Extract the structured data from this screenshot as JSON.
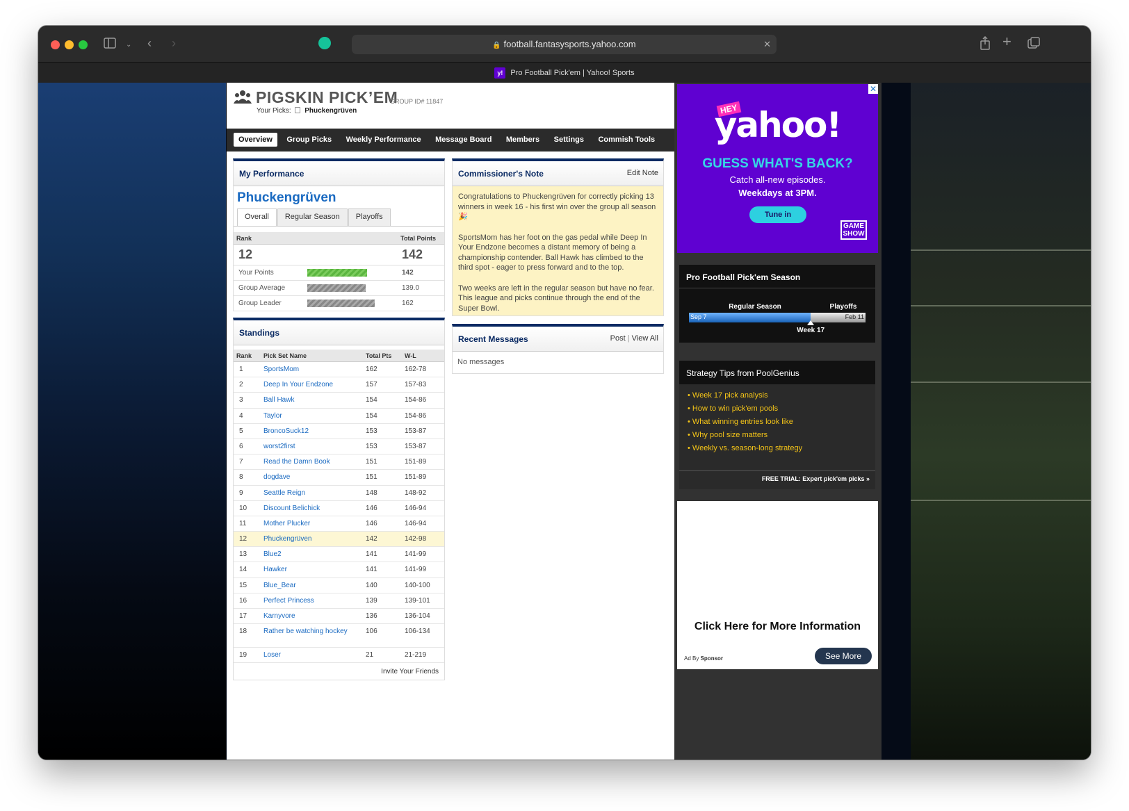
{
  "browser": {
    "url": "football.fantasysports.yahoo.com",
    "tab_title": "Pro Football Pick'em | Yahoo! Sports",
    "tab_favicon": "y!"
  },
  "header": {
    "brand": "PIGSKIN PICK’EM",
    "group_id": "GROUP ID# 11847",
    "your_picks_label": "Your Picks:",
    "your_picks_name": "Phuckengrüven"
  },
  "nav": [
    "Overview",
    "Group Picks",
    "Weekly Performance",
    "Message Board",
    "Members",
    "Settings",
    "Commish Tools"
  ],
  "performance": {
    "title": "My Performance",
    "name": "Phuckengrüven",
    "tabs": [
      "Overall",
      "Regular Season",
      "Playoffs"
    ],
    "rank_label": "Rank",
    "points_label": "Total Points",
    "rank": "12",
    "total_points": "142",
    "rows": [
      {
        "label": "Your Points",
        "value": "142"
      },
      {
        "label": "Group Average",
        "value": "139.0"
      },
      {
        "label": "Group Leader",
        "value": "162"
      }
    ]
  },
  "standings": {
    "title": "Standings",
    "headers": [
      "Rank",
      "Pick Set Name",
      "Total Pts",
      "W-L"
    ],
    "rows": [
      [
        "1",
        "SportsMom",
        "162",
        "162-78"
      ],
      [
        "2",
        "Deep In Your Endzone",
        "157",
        "157-83"
      ],
      [
        "3",
        "Ball Hawk",
        "154",
        "154-86"
      ],
      [
        "4",
        "Taylor",
        "154",
        "154-86"
      ],
      [
        "5",
        "BroncoSuck12",
        "153",
        "153-87"
      ],
      [
        "6",
        "worst2first",
        "153",
        "153-87"
      ],
      [
        "7",
        "Read the Damn Book",
        "151",
        "151-89"
      ],
      [
        "8",
        "dogdave",
        "151",
        "151-89"
      ],
      [
        "9",
        "Seattle Reign",
        "148",
        "148-92"
      ],
      [
        "10",
        "Discount Belichick",
        "146",
        "146-94"
      ],
      [
        "11",
        "Mother Plucker",
        "146",
        "146-94"
      ],
      [
        "12",
        "Phuckengrüven",
        "142",
        "142-98"
      ],
      [
        "13",
        "Blue2",
        "141",
        "141-99"
      ],
      [
        "14",
        "Hawker",
        "141",
        "141-99"
      ],
      [
        "15",
        "Blue_Bear",
        "140",
        "140-100"
      ],
      [
        "16",
        "Perfect Princess",
        "139",
        "139-101"
      ],
      [
        "17",
        "Karnyvore",
        "136",
        "136-104"
      ],
      [
        "18",
        "Rather be watching hockey",
        "106",
        "106-134"
      ],
      [
        "19",
        "Loser",
        "21",
        "21-219"
      ]
    ],
    "invite": "Invite Your Friends"
  },
  "commissioner": {
    "title": "Commissioner's Note",
    "edit": "Edit Note",
    "paragraphs": [
      "Congratulations to Phuckengrüven for correctly picking 13 winners in week 16 - his first win over the group all season 🎉",
      "SportsMom has her foot on the gas pedal while Deep In Your Endzone becomes a distant memory of being a championship contender. Ball Hawk has climbed to the third spot - eager to press forward and to the top.",
      "Two weeks are left in the regular season but have no fear. This league and picks continue through the end of the Super Bowl."
    ]
  },
  "messages": {
    "title": "Recent Messages",
    "post": "Post",
    "view_all": "View All",
    "empty": "No messages"
  },
  "ad": {
    "hey": "HEY",
    "brand": "yahoo!",
    "headline": "GUESS WHAT'S BACK?",
    "line1": "Catch all-new episodes.",
    "line2": "Weekdays at 3PM.",
    "cta": "Tune in",
    "logo1": "GAME",
    "logo2": "SHOW"
  },
  "season": {
    "title": "Pro Football Pick'em Season",
    "regular": "Regular Season",
    "playoffs": "Playoffs",
    "start": "Sep 7",
    "end": "Feb 11",
    "current": "Week 17",
    "progress": 0.69
  },
  "tips": {
    "title": "Strategy Tips from PoolGenius",
    "items": [
      "Week 17 pick analysis",
      "How to win pick'em pools",
      "What winning entries look like",
      "Why pool size matters",
      "Weekly vs. season-long strategy"
    ],
    "footer": "FREE TRIAL: Expert pick'em picks »"
  },
  "ad2": {
    "text": "Click Here for More Information",
    "ad_by": "Ad By",
    "sponsor": "Sponsor",
    "cta": "See More"
  },
  "colors": {
    "brand_blue": "#0a2a63",
    "link": "#1a6ac1",
    "yahoo_purple": "#5f01d1",
    "tip_yellow": "#f5c518",
    "highlight_row": "#fdf7d4"
  }
}
